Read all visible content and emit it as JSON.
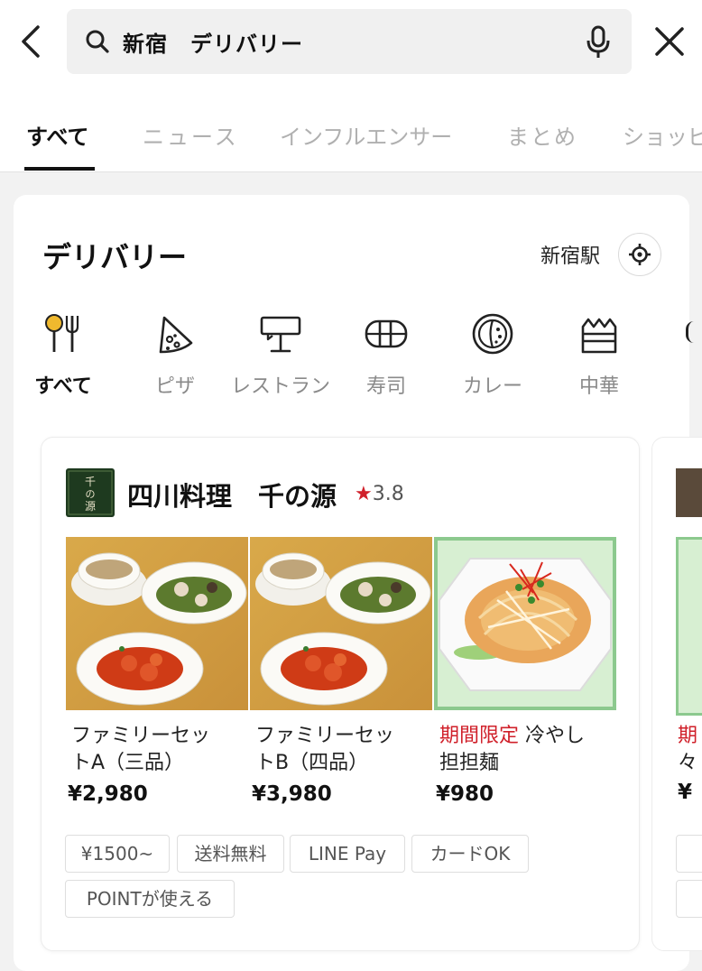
{
  "search": {
    "query": "新宿　デリバリー"
  },
  "tabs": [
    {
      "label": "すべて",
      "active": true
    },
    {
      "label": "ニュース"
    },
    {
      "label": "インフルエンサー"
    },
    {
      "label": "まとめ"
    },
    {
      "label": "ショッピ"
    }
  ],
  "delivery": {
    "title": "デリバリー",
    "station": "新宿駅",
    "categories": [
      {
        "label": "すべて",
        "icon": "fork-knife-icon",
        "active": true
      },
      {
        "label": "ピザ",
        "icon": "pizza-icon"
      },
      {
        "label": "レストラン",
        "icon": "restaurant-icon"
      },
      {
        "label": "寿司",
        "icon": "sushi-icon"
      },
      {
        "label": "カレー",
        "icon": "curry-icon"
      },
      {
        "label": "中華",
        "icon": "chinese-food-icon"
      }
    ]
  },
  "shop": {
    "name": "四川料理　千の源",
    "logo_text": "千の源",
    "rating_star": "★",
    "rating": "3.8",
    "menu": [
      {
        "name_line1": "ファミリーセッ",
        "name_line2": "トA（三品）",
        "price": "¥2,980"
      },
      {
        "name_line1": "ファミリーセッ",
        "name_line2": "トB（四品）",
        "price": "¥3,980"
      },
      {
        "promo": "期間限定",
        "name_line1": " 冷やし",
        "name_line2": "担担麺",
        "price": "¥980"
      }
    ],
    "tags": [
      "¥1500~",
      "送料無料",
      "LINE Pay",
      "カードOK",
      "POINTが使える"
    ]
  },
  "next_shop_peek": {
    "text_line1": "期",
    "text_line2": "々",
    "price_peek": "¥"
  },
  "colors": {
    "accent_red": "#d0202a",
    "logo_green": "#1e3a1f",
    "photo_border_green": "#8cc98e"
  }
}
